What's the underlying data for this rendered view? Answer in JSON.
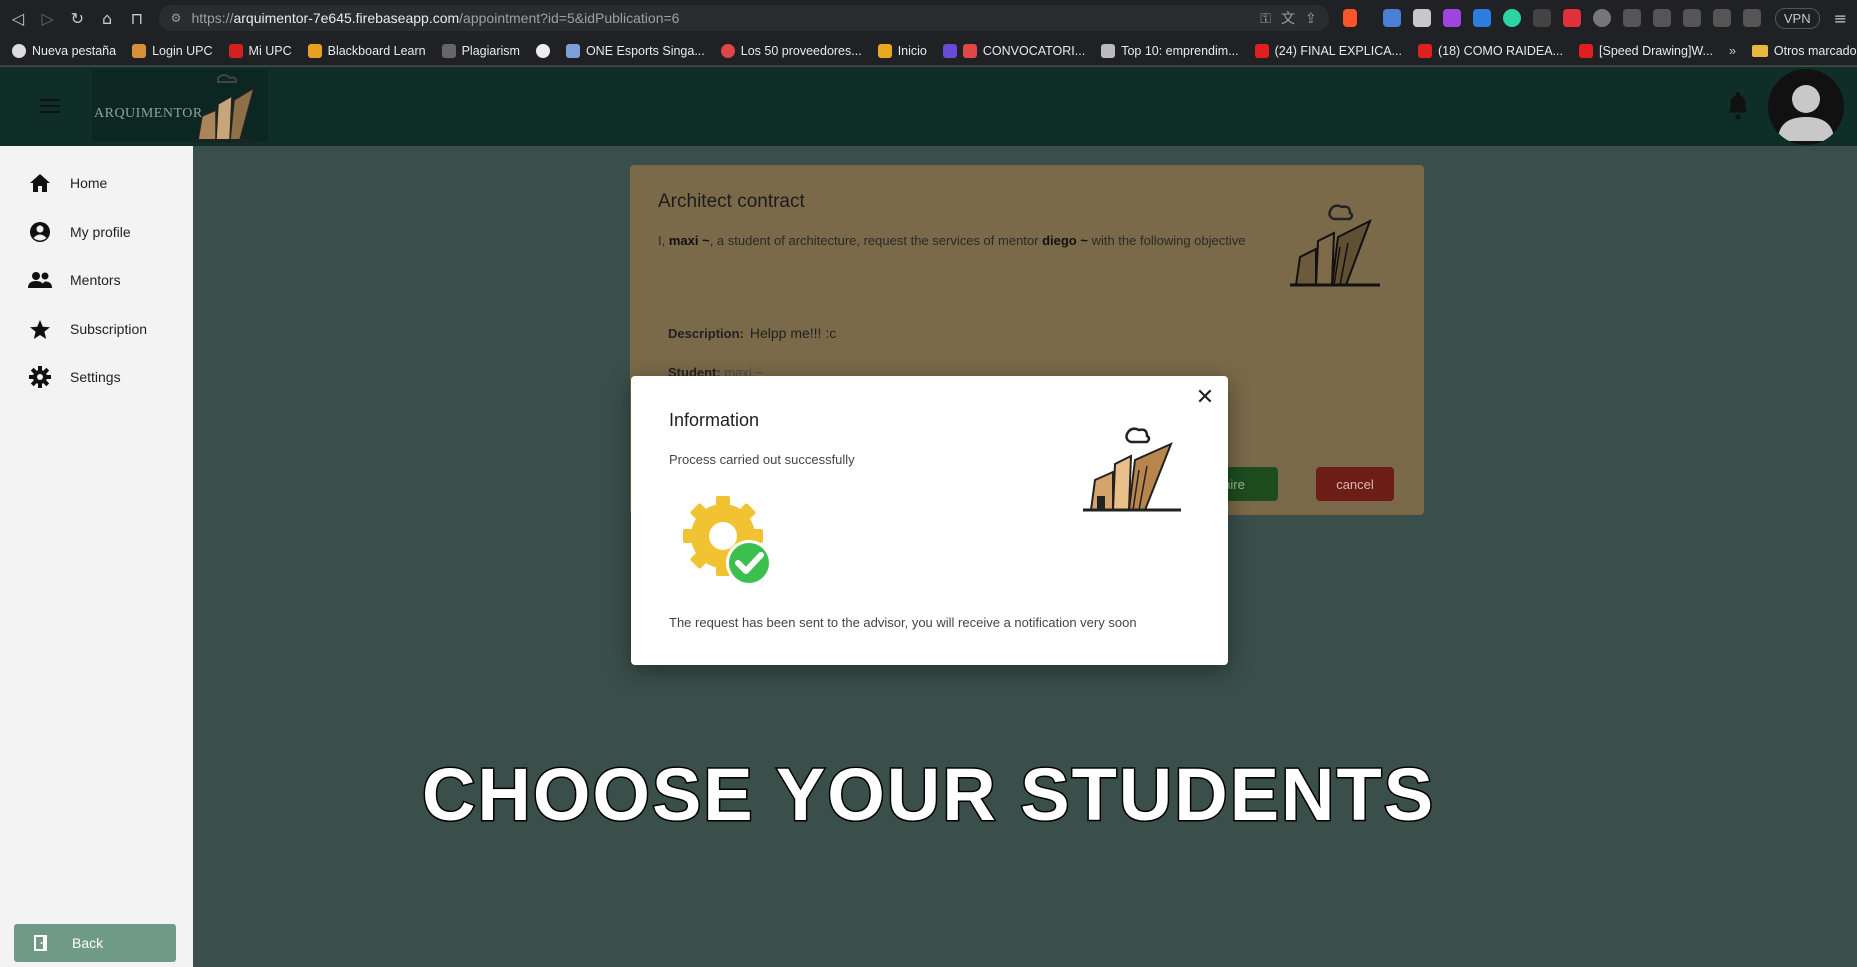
{
  "browser": {
    "url_prefix": "https://",
    "url_host": "arquimentor-7e645.firebaseapp.com",
    "url_path": "/appointment?id=5&idPublication=6",
    "vpn_label": "VPN",
    "bookmarks": [
      "Nueva pestaña",
      "Login UPC",
      "Mi UPC",
      "Blackboard Learn",
      "Plagiarism",
      "",
      "ONE Esports Singa...",
      "Los 50 proveedores...",
      "Inicio",
      "CONVOCATORI...",
      "Top 10: emprendim...",
      "(24) FINAL EXPLICA...",
      "(18) COMO RAIDEA...",
      "[Speed Drawing]W..."
    ],
    "bookmarks_more": "»",
    "other_bookmarks": "Otros marcadores"
  },
  "header": {
    "logo_text": "ARQUIMENTOR"
  },
  "sidebar": {
    "items": [
      {
        "label": "Home",
        "icon": "home-icon"
      },
      {
        "label": "My profile",
        "icon": "account-circle-icon"
      },
      {
        "label": "Mentors",
        "icon": "people-icon"
      },
      {
        "label": "Subscription",
        "icon": "star-icon"
      },
      {
        "label": "Settings",
        "icon": "gear-icon"
      }
    ],
    "back_label": "Back"
  },
  "card": {
    "title": "Architect contract",
    "text_pre": "I, ",
    "student_name": "maxi ~",
    "text_mid": ", a student of architecture, request the services of mentor ",
    "mentor_name": "diego ~",
    "text_post": " with the following objective",
    "description_label": "Description:",
    "description_value": "Helpp me!!! :c",
    "student_label": "Student:",
    "student_value": "maxi ~",
    "hire_label": "hire",
    "cancel_label": "cancel"
  },
  "modal": {
    "title": "Information",
    "message": "Process carried out successfully",
    "note": "The request has been sent to the advisor, you will receive a notification very soon",
    "close_symbol": "✕"
  },
  "caption": "CHOOSE YOUR STUDENTS"
}
